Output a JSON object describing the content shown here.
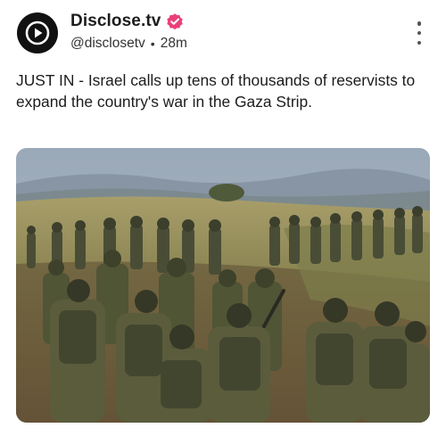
{
  "account": {
    "display_name": "Disclose.tv",
    "handle": "@disclosetv",
    "separator": "•",
    "time_ago": "28m",
    "verified": true,
    "verified_color": "#e9407a",
    "avatar_icon": "play-icon"
  },
  "post": {
    "text": "JUST IN - Israel calls up tens of thousands of reservists to expand the country's war in the Gaza Strip.",
    "media": {
      "type": "photo",
      "subject": "soldiers-walking-in-field"
    }
  },
  "menu": {
    "icon": "more-vertical-icon"
  }
}
